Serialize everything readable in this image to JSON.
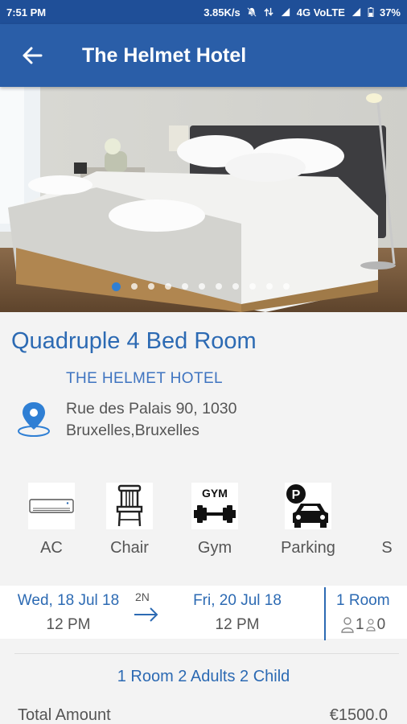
{
  "status_bar": {
    "time": "7:51 PM",
    "speed": "3.85K/s",
    "network": "4G VoLTE",
    "battery": "37%"
  },
  "app_bar": {
    "title": "The Helmet Hotel"
  },
  "gallery": {
    "dot_count": 11,
    "active_index": 0
  },
  "room": {
    "title": "Quadruple 4 Bed Room",
    "hotel_name": "THE HELMET HOTEL",
    "address_line1": "Rue des Palais 90, 1030",
    "address_line2": "Bruxelles,Bruxelles"
  },
  "amenities": [
    {
      "label": "AC",
      "icon": "ac-icon"
    },
    {
      "label": "Chair",
      "icon": "chair-icon"
    },
    {
      "label": "Gym",
      "icon": "gym-icon",
      "icon_text": "GYM"
    },
    {
      "label": "Parking",
      "icon": "parking-icon",
      "icon_text": "P"
    },
    {
      "label": "S",
      "icon": "partial-icon"
    }
  ],
  "booking": {
    "checkin_date": "Wed, 18 Jul 18",
    "checkin_time": "12 PM",
    "nights": "2N",
    "checkout_date": "Fri, 20 Jul 18",
    "checkout_time": "12 PM",
    "rooms": "1 Room",
    "adults": "1",
    "children": "0",
    "summary": "1 Room 2 Adults 2 Child",
    "total_label": "Total Amount",
    "total_value": "€1500.0"
  },
  "colors": {
    "app_bar": "#2a5ea8",
    "status_bar": "#1f4f98",
    "accent": "#2c6ab3"
  }
}
